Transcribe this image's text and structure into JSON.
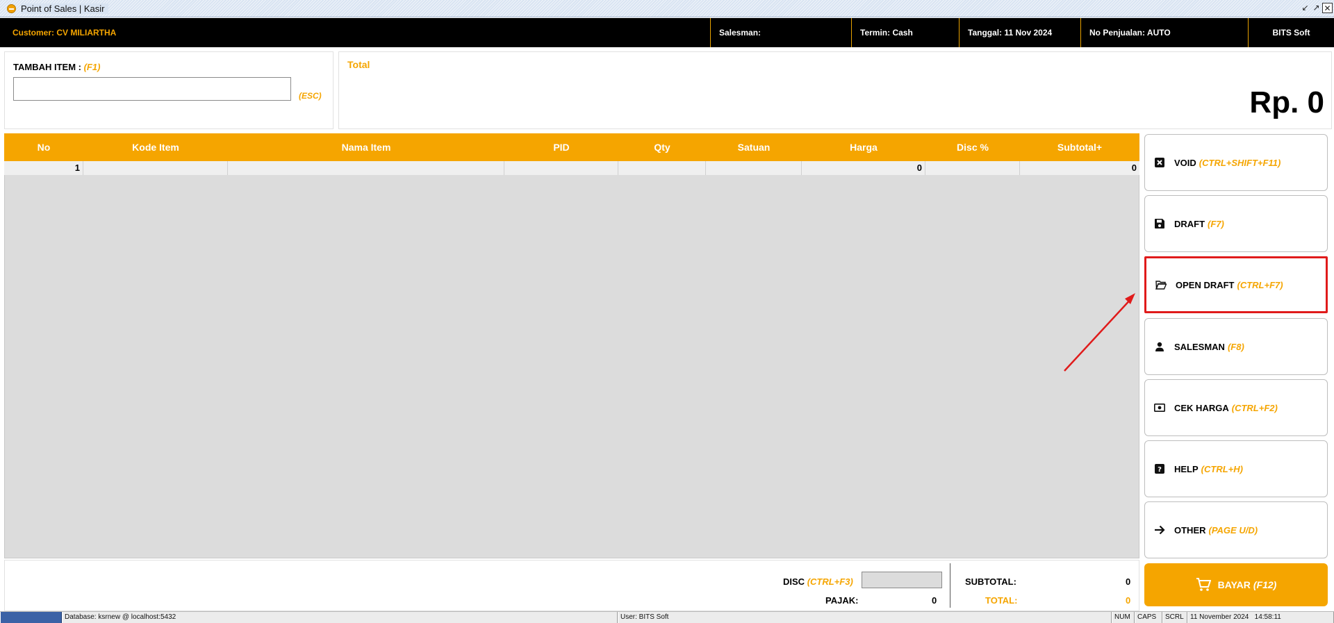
{
  "window": {
    "title": "Point of Sales | Kasir",
    "controls": [
      "↙",
      "↗",
      "✕"
    ]
  },
  "info": {
    "customer": "Customer: CV MILIARTHA",
    "salesman": "Salesman:",
    "termin": "Termin: Cash",
    "tanggal": "Tanggal: 11 Nov 2024",
    "no_penjualan": "No Penjualan: AUTO",
    "company": "BITS Soft"
  },
  "add_item": {
    "label": "TAMBAH ITEM :",
    "shortcut": "(F1)",
    "value": "",
    "esc": "(ESC)"
  },
  "total": {
    "label": "Total",
    "amount": "Rp. 0"
  },
  "grid": {
    "headers": [
      "No",
      "Kode Item",
      "Nama Item",
      "PID",
      "Qty",
      "Satuan",
      "Harga",
      "Disc %",
      "Subtotal+"
    ],
    "rows": [
      {
        "no": "1",
        "kode": "",
        "nama": "",
        "pid": "",
        "qty": "",
        "satuan": "",
        "harga": "0",
        "disc": "",
        "subtotal": "0"
      }
    ]
  },
  "actions": [
    {
      "label": "VOID",
      "shortcut": "(CTRL+SHIFT+F11)",
      "icon": "void-icon"
    },
    {
      "label": "DRAFT",
      "shortcut": "(F7)",
      "icon": "save-icon"
    },
    {
      "label": "OPEN DRAFT",
      "shortcut": "(CTRL+F7)",
      "icon": "folder-open-icon"
    },
    {
      "label": "SALESMAN",
      "shortcut": "(F8)",
      "icon": "person-icon"
    },
    {
      "label": "CEK HARGA",
      "shortcut": "(CTRL+F2)",
      "icon": "money-icon"
    },
    {
      "label": "HELP",
      "shortcut": "(CTRL+H)",
      "icon": "help-icon"
    },
    {
      "label": "OTHER",
      "shortcut": "(PAGE U/D)",
      "icon": "arrow-right-icon"
    }
  ],
  "summary": {
    "disc_label": "DISC",
    "disc_shortcut": "(CTRL+F3)",
    "disc_value": "",
    "pajak_label": "PAJAK:",
    "pajak_value": "0",
    "subtotal_label": "SUBTOTAL:",
    "subtotal_value": "0",
    "total_label": "TOTAL:",
    "total_value": "0"
  },
  "bayar": {
    "label": "BAYAR",
    "shortcut": "(F12)"
  },
  "status": {
    "database": "Database: ksrnew @ localhost:5432",
    "user": "User: BITS Soft",
    "num": "NUM",
    "caps": "CAPS",
    "scrl": "SCRL",
    "datetime": "11 November 2024   14:58:11"
  },
  "colors": {
    "accent": "#f5a500",
    "annotation": "#e01b1b",
    "grid_bg": "#dcdcdc"
  }
}
